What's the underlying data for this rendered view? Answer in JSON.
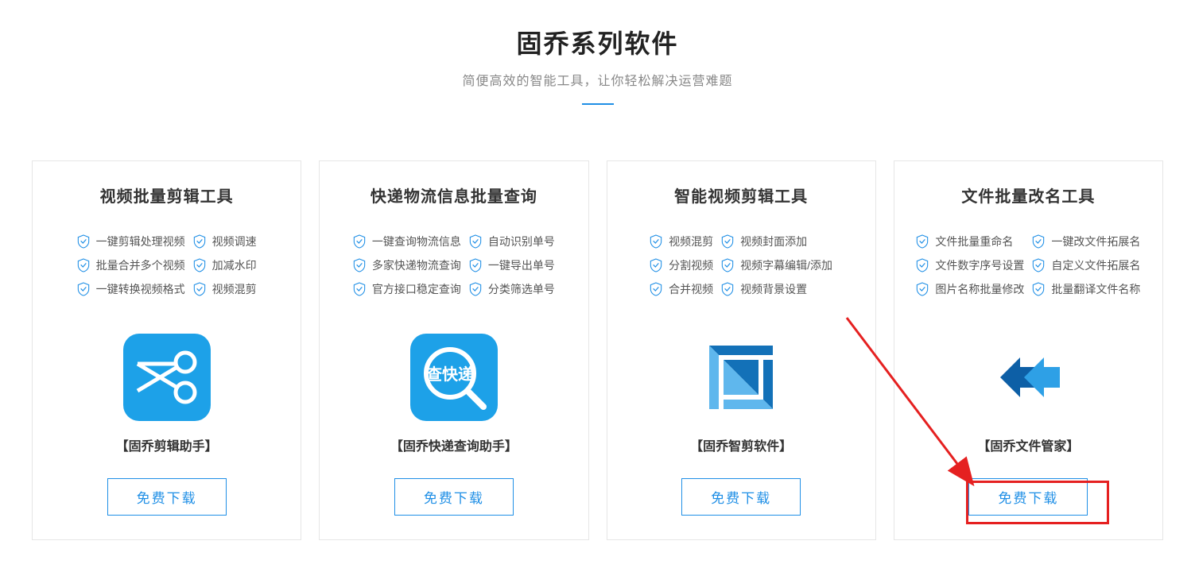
{
  "header": {
    "title": "固乔系列软件",
    "subtitle": "简便高效的智能工具，让你轻松解决运营难题"
  },
  "cards": [
    {
      "title": "视频批量剪辑工具",
      "features_left": [
        "一键剪辑处理视频",
        "批量合并多个视频",
        "一键转换视频格式"
      ],
      "features_right": [
        "视频调速",
        "加减水印",
        "视频混剪"
      ],
      "product_name": "【固乔剪辑助手】",
      "download": "免费下载",
      "icon": "scissors"
    },
    {
      "title": "快递物流信息批量查询",
      "features_left": [
        "一键查询物流信息",
        "多家快递物流查询",
        "官方接口稳定查询"
      ],
      "features_right": [
        "自动识别单号",
        "一键导出单号",
        "分类筛选单号"
      ],
      "product_name": "【固乔快递查询助手】",
      "download": "免费下载",
      "icon": "express"
    },
    {
      "title": "智能视频剪辑工具",
      "features_left": [
        "视频混剪",
        "分割视频",
        "合并视频"
      ],
      "features_right": [
        "视频封面添加",
        "视频字幕编辑/添加",
        "视频背景设置"
      ],
      "product_name": "【固乔智剪软件】",
      "download": "免费下载",
      "icon": "crop"
    },
    {
      "title": "文件批量改名工具",
      "features_left": [
        "文件批量重命名",
        "文件数字序号设置",
        "图片名称批量修改"
      ],
      "features_right": [
        "一键改文件拓展名",
        "自定义文件拓展名",
        "批量翻译文件名称"
      ],
      "product_name": "【固乔文件管家】",
      "download": "免费下载",
      "icon": "arrows"
    }
  ]
}
